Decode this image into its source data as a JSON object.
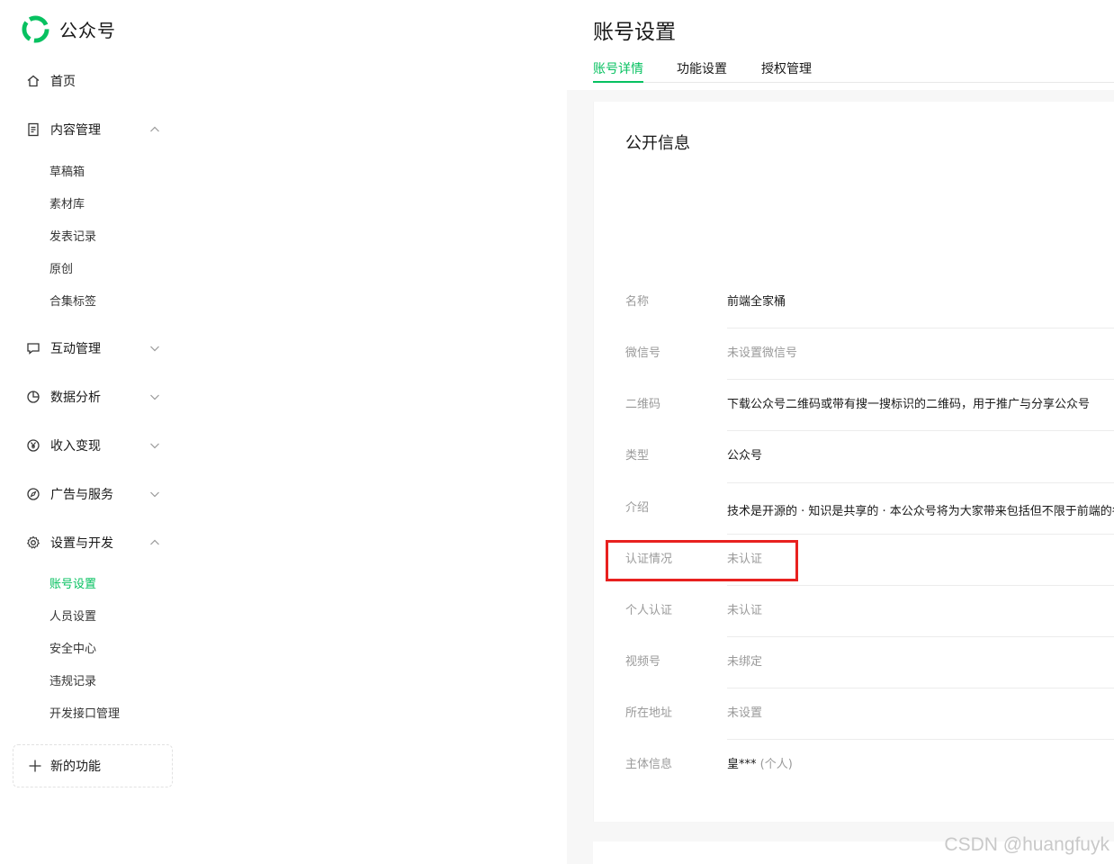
{
  "app": {
    "title": "公众号"
  },
  "sidebar": {
    "items": [
      {
        "label": "首页",
        "icon": "home-icon"
      },
      {
        "label": "内容管理",
        "icon": "document-icon",
        "expanded": true,
        "children": [
          "草稿箱",
          "素材库",
          "发表记录",
          "原创",
          "合集标签"
        ]
      },
      {
        "label": "互动管理",
        "icon": "chat-icon",
        "expanded": false
      },
      {
        "label": "数据分析",
        "icon": "pie-chart-icon",
        "expanded": false
      },
      {
        "label": "收入变现",
        "icon": "yen-icon",
        "expanded": false
      },
      {
        "label": "广告与服务",
        "icon": "compass-icon",
        "expanded": false
      },
      {
        "label": "设置与开发",
        "icon": "gear-icon",
        "expanded": true,
        "children": [
          "账号设置",
          "人员设置",
          "安全中心",
          "违规记录",
          "开发接口管理"
        ]
      }
    ],
    "new_feature": "新的功能"
  },
  "main": {
    "title": "账号设置",
    "tabs": [
      "账号详情",
      "功能设置",
      "授权管理"
    ],
    "active_tab": "账号详情",
    "section_title": "公开信息",
    "rows": [
      {
        "label": "名称",
        "value": "前端全家桶"
      },
      {
        "label": "微信号",
        "value": "未设置微信号"
      },
      {
        "label": "二维码",
        "value": "下载公众号二维码或带有搜一搜标识的二维码，用于推广与分享公众号"
      },
      {
        "label": "类型",
        "value": "公众号"
      },
      {
        "label": "介绍",
        "value": "技术是开源的 · 知识是共享的 · 本公众号将为大家带来包括但不限于前端的各和"
      },
      {
        "label": "认证情况",
        "value": "未认证"
      },
      {
        "label": "个人认证",
        "value": "未认证"
      },
      {
        "label": "视频号",
        "value": "未绑定"
      },
      {
        "label": "所在地址",
        "value": "未设置"
      },
      {
        "label": "主体信息",
        "value": "皇***",
        "suffix": "(个人)"
      }
    ]
  },
  "watermark": "CSDN @huangfuyk",
  "colors": {
    "accent": "#07c160",
    "highlight": "#e8211f",
    "muted": "#9a9a9a"
  }
}
